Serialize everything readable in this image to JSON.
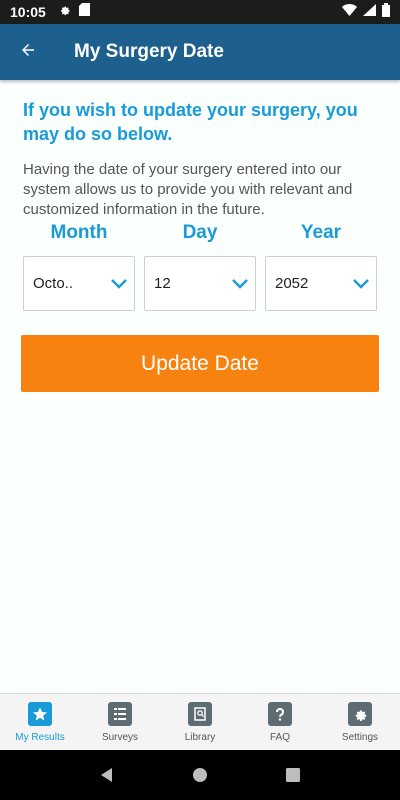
{
  "status_bar": {
    "time": "10:05"
  },
  "app_bar": {
    "title": "My Surgery Date"
  },
  "main": {
    "headline": "If you wish to update your surgery, you may do so below.",
    "description": "Having the date of your surgery entered into our system allows us to provide you with relevant and customized information in the future.",
    "fields": {
      "month": {
        "label": "Month",
        "value": "Octo.."
      },
      "day": {
        "label": "Day",
        "value": "12"
      },
      "year": {
        "label": "Year",
        "value": "2052"
      }
    },
    "update_button_label": "Update Date"
  },
  "bottom_nav": {
    "items": [
      {
        "label": "My Results",
        "icon": "star-icon",
        "active": true
      },
      {
        "label": "Surveys",
        "icon": "checklist-icon",
        "active": false
      },
      {
        "label": "Library",
        "icon": "book-search-icon",
        "active": false
      },
      {
        "label": "FAQ",
        "icon": "question-icon",
        "active": false
      },
      {
        "label": "Settings",
        "icon": "gear-icon",
        "active": false
      }
    ]
  },
  "colors": {
    "app_bar": "#1d5f8d",
    "accent": "#199bd8",
    "button": "#f8820f"
  }
}
